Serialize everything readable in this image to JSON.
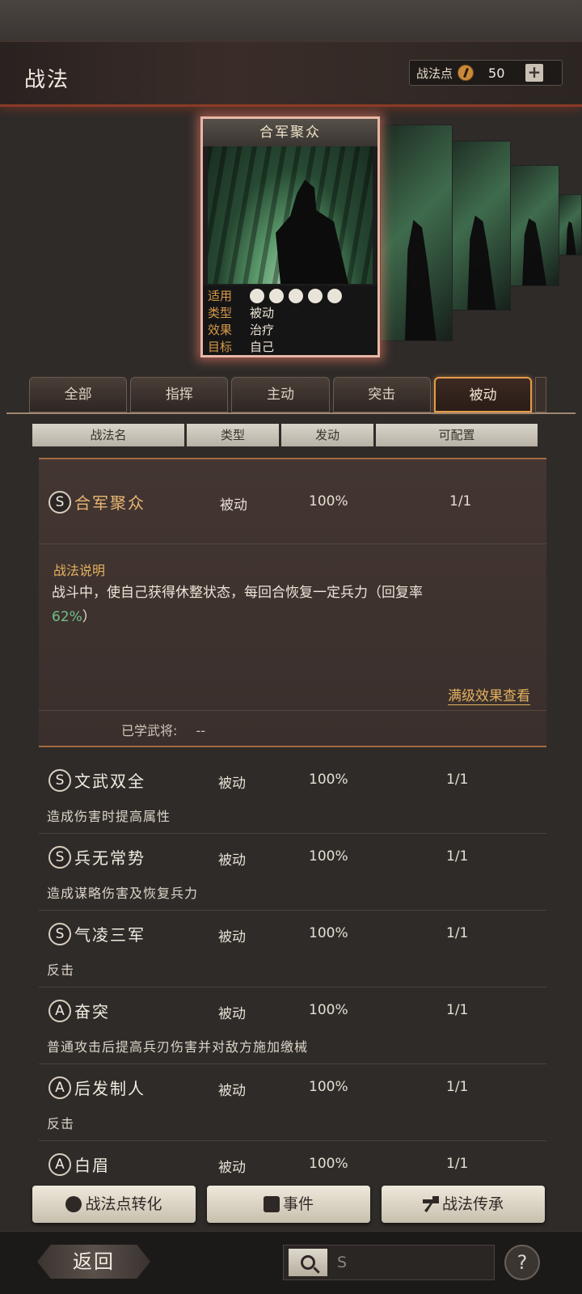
{
  "header": {
    "title": "战法",
    "points_label": "战法点",
    "points_value": "50",
    "add_label": "+"
  },
  "card": {
    "name": "合军聚众",
    "info": [
      {
        "key": "适用",
        "value": ""
      },
      {
        "key": "类型",
        "value": "被动"
      },
      {
        "key": "效果",
        "value": "治疗"
      },
      {
        "key": "目标",
        "value": "自己"
      }
    ]
  },
  "tabs": [
    "全部",
    "指挥",
    "主动",
    "突击",
    "被动"
  ],
  "active_tab": "被动",
  "columns": [
    "战法名",
    "类型",
    "发动",
    "可配置"
  ],
  "expanded": {
    "grade": "S",
    "name": "合军聚众",
    "type": "被动",
    "rate": "100%",
    "config": "1/1",
    "desc_title": "战法说明",
    "desc_text": "战斗中，使自己获得休整状态，每回合恢复一定兵力（回复率",
    "desc_highlight": "62%",
    "desc_end": "）",
    "full_link": "满级效果查看",
    "learned_label": "已学武将:",
    "learned_value": "--"
  },
  "items": [
    {
      "grade": "S",
      "name": "文武双全",
      "type": "被动",
      "rate": "100%",
      "config": "1/1",
      "desc": "造成伤害时提高属性"
    },
    {
      "grade": "S",
      "name": "兵无常势",
      "type": "被动",
      "rate": "100%",
      "config": "1/1",
      "desc": "造成谋略伤害及恢复兵力"
    },
    {
      "grade": "S",
      "name": "气凌三军",
      "type": "被动",
      "rate": "100%",
      "config": "1/1",
      "desc": "反击"
    },
    {
      "grade": "A",
      "name": "奋突",
      "type": "被动",
      "rate": "100%",
      "config": "1/1",
      "desc": "普通攻击后提高兵刃伤害并对敌方施加缴械"
    },
    {
      "grade": "A",
      "name": "后发制人",
      "type": "被动",
      "rate": "100%",
      "config": "1/1",
      "desc": "反击"
    },
    {
      "grade": "A",
      "name": "白眉",
      "type": "被动",
      "rate": "100%",
      "config": "1/1",
      "desc": ""
    }
  ],
  "actions": {
    "convert": "战法点转化",
    "event": "事件",
    "inherit": "战法传承"
  },
  "footer": {
    "back": "返回",
    "search_value": "S",
    "help": "?"
  },
  "colors": {
    "accent": "#e59b4a",
    "highlight": "#6fc08a",
    "gold_text": "#e3b25e"
  }
}
